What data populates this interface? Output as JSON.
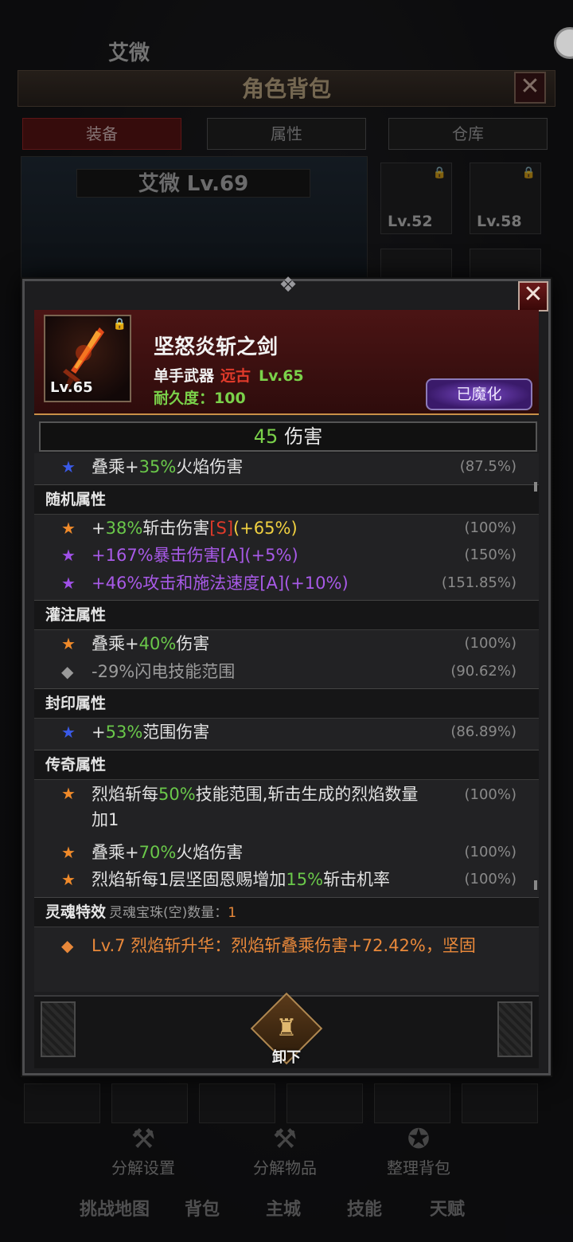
{
  "background": {
    "top_name": "艾微",
    "title": "角色背包",
    "close": "✕",
    "tabs": [
      "装备",
      "属性",
      "仓库"
    ],
    "char_name": "艾微 Lv.69",
    "slots": [
      {
        "lv": "Lv.52"
      },
      {
        "lv": "Lv.58"
      }
    ],
    "actions": [
      "分解设置",
      "分解物品",
      "整理背包"
    ],
    "nav": [
      "挑战地图",
      "背包",
      "主城",
      "技能",
      "天赋"
    ]
  },
  "item": {
    "icon_level": "Lv.65",
    "name": "坚怒炎斩之剑",
    "type": "单手武器",
    "rarity": "远古",
    "level": "Lv.65",
    "durability": "耐久度：100",
    "enchant_button": "已魔化",
    "damage_value": "45",
    "damage_label": "伤害",
    "close": "✕"
  },
  "base_stat": {
    "pre": "叠乘+",
    "hl": "35%",
    "post": "火焰伤害",
    "pct": "(87.5%)"
  },
  "sections": {
    "random": {
      "title": "随机属性",
      "rows": [
        {
          "pre": "+",
          "hl": "38%",
          "mid": "斩击伤害",
          "tag": "[S]",
          "post": "(+65%)",
          "pct": "(100%)"
        },
        {
          "text": "+167%暴击伤害[A](+5%)",
          "pct": "(150%)"
        },
        {
          "text": "+46%攻击和施法速度[A](+10%)",
          "pct": "(151.85%)"
        }
      ]
    },
    "infuse": {
      "title": "灌注属性",
      "rows": [
        {
          "pre": "叠乘+",
          "hl": "40%",
          "post": "伤害",
          "pct": "(100%)"
        },
        {
          "text": "-29%闪电技能范围",
          "pct": "(90.62%)"
        }
      ]
    },
    "seal": {
      "title": "封印属性",
      "rows": [
        {
          "pre": "+",
          "hl": "53%",
          "post": "范围伤害",
          "pct": "(86.89%)"
        }
      ]
    },
    "legend": {
      "title": "传奇属性",
      "rows": [
        {
          "pre": "烈焰斩每",
          "hl": "50%",
          "post": "技能范围,斩击生成的烈焰数量加1",
          "pct": "(100%)"
        },
        {
          "pre": "叠乘+",
          "hl": "70%",
          "post": "火焰伤害",
          "pct": "(100%)"
        },
        {
          "pre": "烈焰斩每1层坚固恩赐增加",
          "hl": "15%",
          "post": "斩击机率",
          "pct": "(100%)"
        }
      ]
    },
    "soul": {
      "title": "灵魂特效",
      "note_label": "灵魂宝珠(空)数量：",
      "note_count": "1",
      "rows": [
        {
          "text": "Lv.7 烈焰斩升华：烈焰斩叠乘伤害+72.42%，坚固"
        }
      ]
    }
  },
  "footer": {
    "unequip": "卸下"
  },
  "glyphs": {
    "star": "★",
    "diamond": "◆",
    "lock": "🔒",
    "ornament": "❖"
  },
  "colors": {
    "highlight_green": "#6ac84a",
    "rarity_red": "#e03a2a",
    "epic_purple": "#a85ae8",
    "legend_orange": "#f08a2a",
    "star_blue": "#3a5ae8"
  }
}
